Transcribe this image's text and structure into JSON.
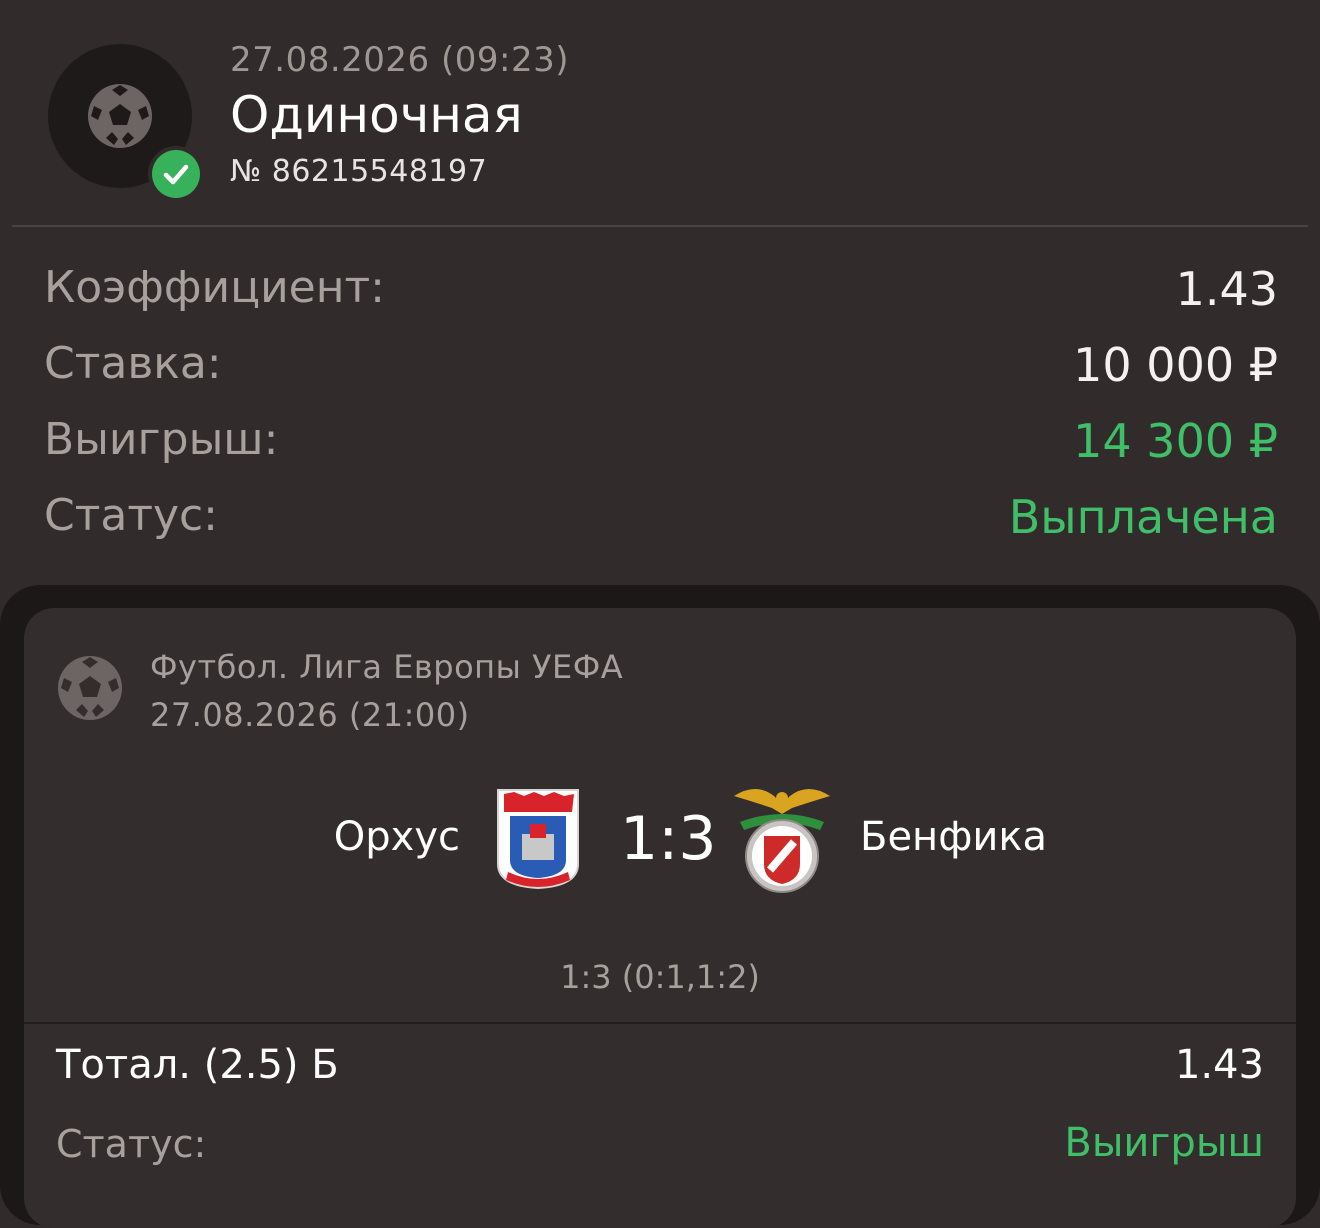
{
  "header": {
    "sport_icon": "soccer-ball-icon",
    "status_icon": "check-circle-icon",
    "date_time": "27.08.2026 (09:23)",
    "bet_type": "Одиночная",
    "bet_number": "№ 86215548197",
    "accent_green": "#38b25a"
  },
  "summary": {
    "coef_label": "Коэффициент:",
    "coef_value": "1.43",
    "stake_label": "Ставка:",
    "stake_value": "10 000 ₽",
    "win_label": "Выигрыш:",
    "win_value": "14 300 ₽",
    "status_label": "Статус:",
    "status_value": "Выплачена"
  },
  "event": {
    "sport_icon": "soccer-ball-icon",
    "league": "Футбол. Лига Европы УЕФА",
    "date_time": "27.08.2026 (21:00)",
    "home_team": "Орхус",
    "home_logo": "agf-aarhus-crest",
    "score": "1:3",
    "away_logo": "benfica-crest",
    "away_team": "Бенфика",
    "half_scores": "1:3 (0:1,1:2)",
    "bet_name": "Тотал. (2.5) Б",
    "bet_odds": "1.43",
    "bet_status_label": "Статус:",
    "bet_status_value": "Выигрыш"
  }
}
